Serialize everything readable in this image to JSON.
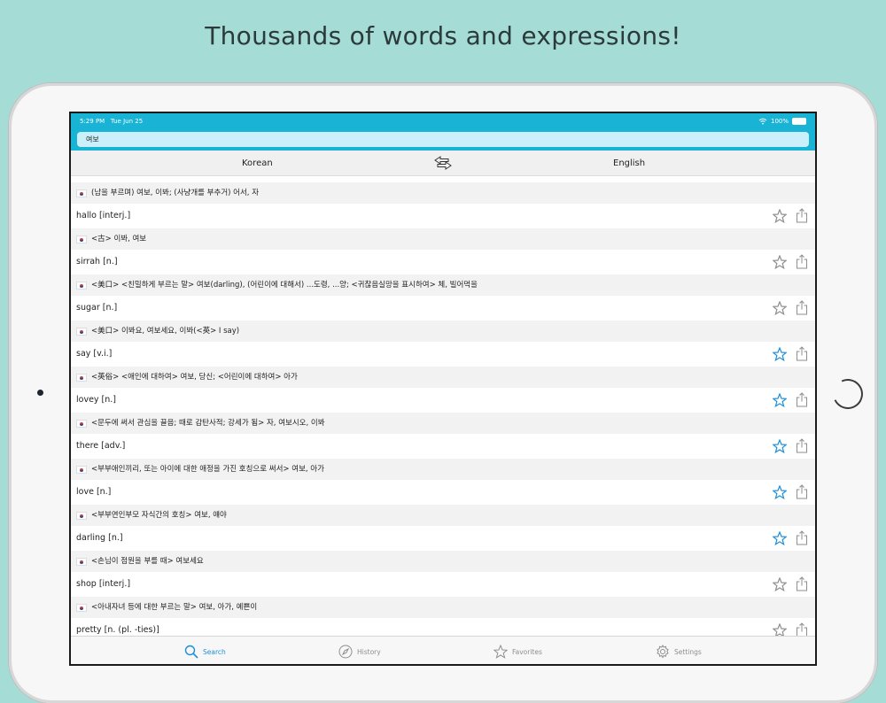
{
  "headline": "Thousands of words and expressions!",
  "status": {
    "time": "5:29 PM",
    "date": "Tue Jun 25",
    "battery": "100%"
  },
  "search": {
    "value": "여보"
  },
  "languages": {
    "left": "Korean",
    "right": "English"
  },
  "results": [
    {
      "korean": "(남을 부르며) 여보, 이봐; (사냥개를 부추거) 어서, 자",
      "english": "hallo [interj.]",
      "favorited": false
    },
    {
      "korean": "<古> 이봐, 여보",
      "english": "sirrah [n.]",
      "favorited": false
    },
    {
      "korean": "<美口> <친밀하게 부르는 말> 여보(darling), (어린이에 대해서) ...도령, ...양; <귀찮음실망을 표시하여> 체, 빌어먹을",
      "english": "sugar [n.]",
      "favorited": false
    },
    {
      "korean": "<美口> 이봐요, 여보세요, 이봐(<英> I say)",
      "english": "say [v.i.]",
      "favorited": true
    },
    {
      "korean": "<英俗> <애인에 대하여> 여보, 당신; <어린이에 대하여> 아가",
      "english": "lovey [n.]",
      "favorited": true
    },
    {
      "korean": "<문두에 써서 관심을 끌음; 때로 감탄사적; 강세가 됨> 자, 여보시오, 이봐",
      "english": "there [adv.]",
      "favorited": true
    },
    {
      "korean": "<부부애인끼리, 또는 아이에 대한 애정을 가진 호칭으로 써서> 여보, 아가",
      "english": "love [n.]",
      "favorited": true
    },
    {
      "korean": "<부부연인부모 자식간의 호칭> 여보, 얘야",
      "english": "darling [n.]",
      "favorited": true
    },
    {
      "korean": "<손님이 점원을 부를 때> 여보세요",
      "english": "shop [interj.]",
      "favorited": false
    },
    {
      "korean": "<아내자녀 등에 대한 부르는 말> 여보, 아가, 예쁜이",
      "english": "pretty [n. (pl. -ties)]",
      "favorited": false
    }
  ],
  "tabs": [
    {
      "label": "Search",
      "icon": "search-icon",
      "active": true
    },
    {
      "label": "History",
      "icon": "compass-icon",
      "active": false
    },
    {
      "label": "Favorites",
      "icon": "star-icon",
      "active": false
    },
    {
      "label": "Settings",
      "icon": "gear-icon",
      "active": false
    }
  ],
  "colors": {
    "accent": "#1d8fd8",
    "topbar": "#19b3d6",
    "background": "#a6dcd6",
    "star_inactive": "#8e8e8e"
  }
}
